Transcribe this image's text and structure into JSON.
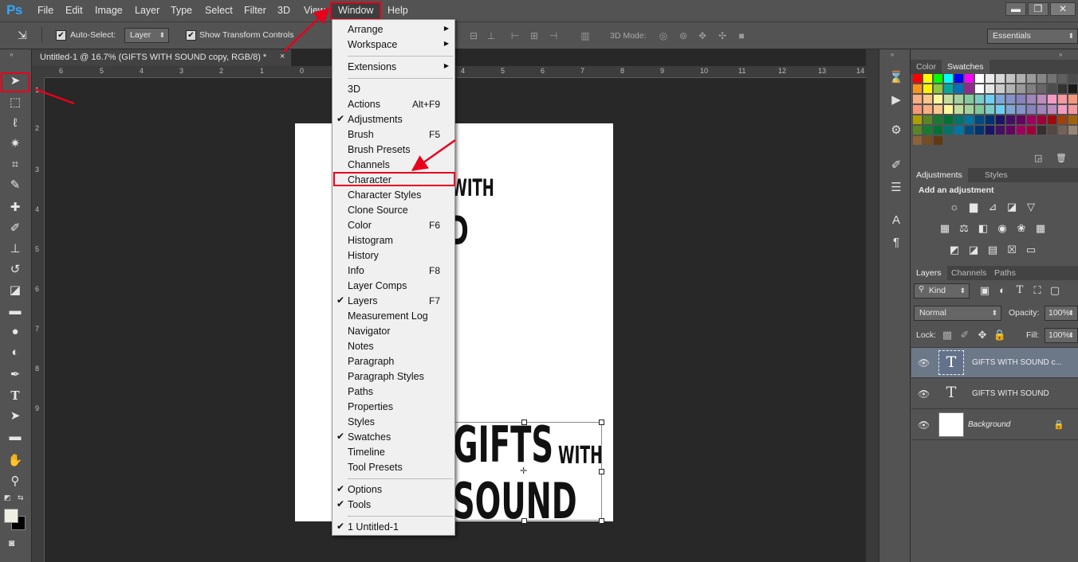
{
  "app": {
    "logo": "Ps"
  },
  "menubar": {
    "items": [
      "File",
      "Edit",
      "Image",
      "Layer",
      "Type",
      "Select",
      "Filter",
      "3D",
      "View",
      "Window",
      "Help"
    ],
    "active": "Window",
    "window_controls": {
      "minimize": "▬",
      "restore": "❐",
      "close": "✕"
    }
  },
  "options_bar": {
    "auto_select_label": "Auto-Select:",
    "auto_select_target": "Layer",
    "show_transform_label": "Show Transform Controls",
    "mode_3d_label": "3D Mode:",
    "workspace": "Essentials"
  },
  "document": {
    "tab_title": "Untitled-1 @ 16.7% (GIFTS WITH  SOUND copy, RGB/8) *",
    "close_glyph": "×",
    "ruler_top_ticks": [
      "6",
      "5",
      "4",
      "3",
      "2",
      "1",
      "0",
      "1",
      "2",
      "3",
      "4",
      "5",
      "6",
      "7",
      "8",
      "9",
      "10",
      "11",
      "12",
      "13",
      "14"
    ],
    "ruler_left_ticks": [
      "1",
      "2",
      "3",
      "4",
      "5",
      "6",
      "7",
      "8",
      "9"
    ],
    "canvas_text": {
      "top_fragment": "WITH",
      "mid_fragment": "D",
      "line1_big": "GIFTS",
      "line1_small": "WITH",
      "line2": "SOUND"
    }
  },
  "window_menu": {
    "items": [
      {
        "label": "Arrange",
        "submenu": true,
        "checked": false,
        "shortcut": ""
      },
      {
        "label": "Workspace",
        "submenu": true,
        "checked": false,
        "shortcut": ""
      },
      {
        "label": "Extensions",
        "submenu": true,
        "checked": false,
        "shortcut": ""
      },
      {
        "label": "3D",
        "submenu": false,
        "checked": false,
        "shortcut": ""
      },
      {
        "label": "Actions",
        "submenu": false,
        "checked": false,
        "shortcut": "Alt+F9"
      },
      {
        "label": "Adjustments",
        "submenu": false,
        "checked": true,
        "shortcut": ""
      },
      {
        "label": "Brush",
        "submenu": false,
        "checked": false,
        "shortcut": "F5"
      },
      {
        "label": "Brush Presets",
        "submenu": false,
        "checked": false,
        "shortcut": ""
      },
      {
        "label": "Channels",
        "submenu": false,
        "checked": false,
        "shortcut": ""
      },
      {
        "label": "Character",
        "submenu": false,
        "checked": false,
        "shortcut": "",
        "highlighted": true
      },
      {
        "label": "Character Styles",
        "submenu": false,
        "checked": false,
        "shortcut": ""
      },
      {
        "label": "Clone Source",
        "submenu": false,
        "checked": false,
        "shortcut": ""
      },
      {
        "label": "Color",
        "submenu": false,
        "checked": false,
        "shortcut": "F6"
      },
      {
        "label": "Histogram",
        "submenu": false,
        "checked": false,
        "shortcut": ""
      },
      {
        "label": "History",
        "submenu": false,
        "checked": false,
        "shortcut": ""
      },
      {
        "label": "Info",
        "submenu": false,
        "checked": false,
        "shortcut": "F8"
      },
      {
        "label": "Layer Comps",
        "submenu": false,
        "checked": false,
        "shortcut": ""
      },
      {
        "label": "Layers",
        "submenu": false,
        "checked": true,
        "shortcut": "F7"
      },
      {
        "label": "Measurement Log",
        "submenu": false,
        "checked": false,
        "shortcut": ""
      },
      {
        "label": "Navigator",
        "submenu": false,
        "checked": false,
        "shortcut": ""
      },
      {
        "label": "Notes",
        "submenu": false,
        "checked": false,
        "shortcut": ""
      },
      {
        "label": "Paragraph",
        "submenu": false,
        "checked": false,
        "shortcut": ""
      },
      {
        "label": "Paragraph Styles",
        "submenu": false,
        "checked": false,
        "shortcut": ""
      },
      {
        "label": "Paths",
        "submenu": false,
        "checked": false,
        "shortcut": ""
      },
      {
        "label": "Properties",
        "submenu": false,
        "checked": false,
        "shortcut": ""
      },
      {
        "label": "Styles",
        "submenu": false,
        "checked": false,
        "shortcut": ""
      },
      {
        "label": "Swatches",
        "submenu": false,
        "checked": true,
        "shortcut": ""
      },
      {
        "label": "Timeline",
        "submenu": false,
        "checked": false,
        "shortcut": ""
      },
      {
        "label": "Tool Presets",
        "submenu": false,
        "checked": false,
        "shortcut": ""
      },
      {
        "label": "Options",
        "submenu": false,
        "checked": true,
        "shortcut": ""
      },
      {
        "label": "Tools",
        "submenu": false,
        "checked": true,
        "shortcut": ""
      },
      {
        "label": "1 Untitled-1",
        "submenu": false,
        "checked": true,
        "shortcut": ""
      }
    ],
    "check_glyph": "✔",
    "arrow_glyph": "▶"
  },
  "panels": {
    "color_tabs": [
      "Color",
      "Swatches"
    ],
    "color_active": "Swatches",
    "adjustments_tabs": [
      "Adjustments",
      "Styles"
    ],
    "adjustments_active": "Adjustments",
    "add_adjustment_label": "Add an adjustment",
    "layers_tabs": [
      "Layers",
      "Channels",
      "Paths"
    ],
    "layers_active": "Layers",
    "filter_kind": "Kind",
    "blend_mode": "Normal",
    "opacity_label": "Opacity:",
    "opacity_value": "100%",
    "lock_label": "Lock:",
    "fill_label": "Fill:",
    "fill_value": "100%",
    "layers": [
      {
        "name": "GIFTS WITH  SOUND c...",
        "type": "text",
        "selected": true
      },
      {
        "name": "GIFTS WITH  SOUND",
        "type": "text",
        "selected": false
      },
      {
        "name": "Background",
        "type": "background",
        "selected": false,
        "locked": true
      }
    ]
  },
  "swatch_colors": [
    "#ff0000",
    "#ffff00",
    "#00ff00",
    "#00ffff",
    "#0000ff",
    "#ff00ff",
    "#ffffff",
    "#ebebeb",
    "#d7d7d7",
    "#c3c3c3",
    "#afafaf",
    "#9b9b9b",
    "#878787",
    "#737373",
    "#5f5f5f",
    "#4b4b4b",
    "#373737",
    "#d7141a",
    "#f7941d",
    "#fff200",
    "#8dc63f",
    "#00a99d",
    "#0072bc",
    "#92278f",
    "#ffffff",
    "#e6e6e6",
    "#cccccc",
    "#b3b3b3",
    "#999999",
    "#808080",
    "#666666",
    "#4d4d4d",
    "#333333",
    "#1a1a1a",
    "#000000",
    "#f26522",
    "#f9ad81",
    "#fdc689",
    "#fff799",
    "#c4df9b",
    "#a3d39c",
    "#82ca9c",
    "#7accc8",
    "#6dcff6",
    "#7da7d9",
    "#8393ca",
    "#8781bd",
    "#a186be",
    "#bd8cbf",
    "#f49ac2",
    "#f6989d",
    "#f7977a",
    "#fbaf5d",
    "#fff568",
    "#f7977a",
    "#f9ad81",
    "#fdc68a",
    "#fff79a",
    "#c6df9c",
    "#a4d49d",
    "#81ca9d",
    "#7bcdc8",
    "#6ecff6",
    "#7ea7d8",
    "#8493ca",
    "#8882be",
    "#a187be",
    "#bc8cbf",
    "#f49bc1",
    "#f5989d",
    "#ed1c24",
    "#f7941d",
    "#aba000",
    "#598527",
    "#197b30",
    "#007236",
    "#00746b",
    "#0076a3",
    "#004b80",
    "#003471",
    "#1b1464",
    "#440e62",
    "#630460",
    "#9e005d",
    "#9e0039",
    "#9e0b0f",
    "#a0410d",
    "#a36209",
    "#8c6239",
    "#754c24",
    "#598527",
    "#197b30",
    "#007236",
    "#00746b",
    "#0076a3",
    "#004b80",
    "#003471",
    "#1b1464",
    "#440e62",
    "#630460",
    "#9e005d",
    "#9e0039",
    "#362f2d",
    "#534741",
    "#736357",
    "#998675",
    "#c69c6d",
    "#a67c52",
    "#8c6239",
    "#754c24",
    "#603913"
  ],
  "accent": {
    "highlight_red": "#e8001c",
    "ps_blue": "#31a8ff"
  }
}
